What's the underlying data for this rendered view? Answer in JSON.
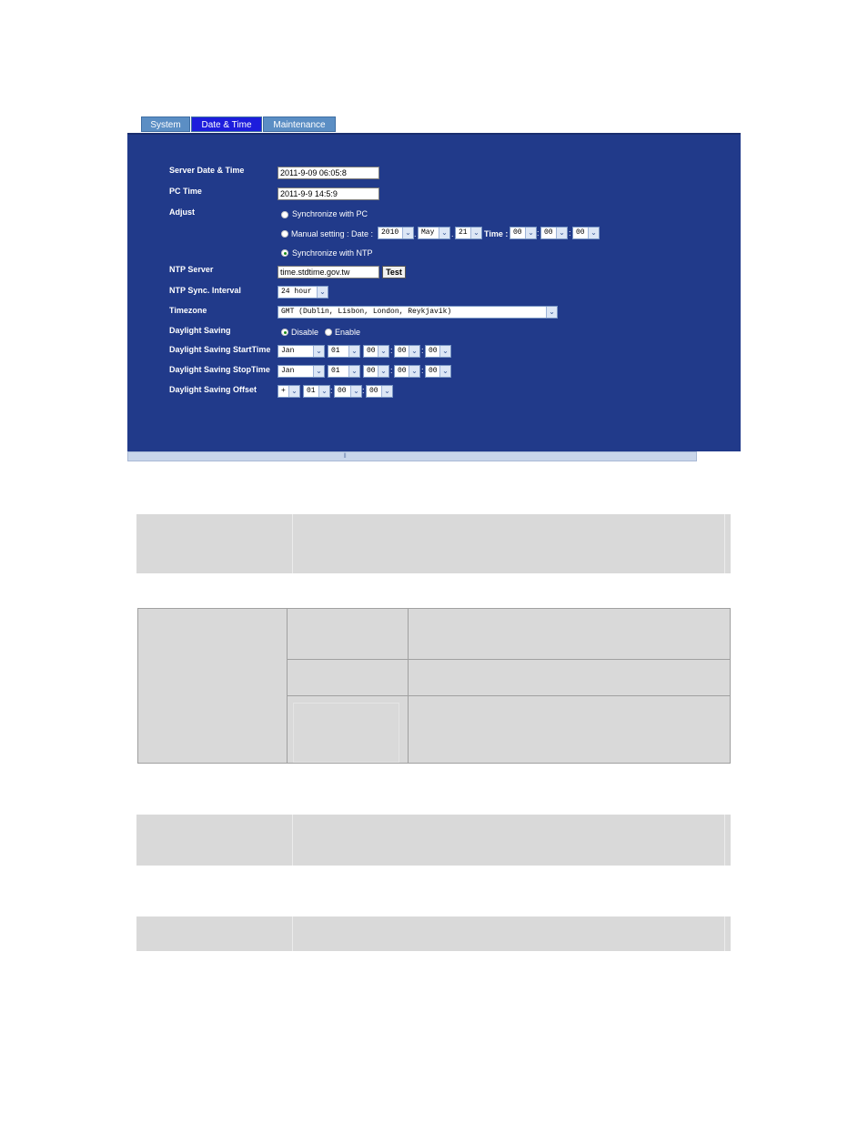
{
  "tabs": [
    {
      "label": "System",
      "active": false
    },
    {
      "label": "Date & Time",
      "active": true
    },
    {
      "label": "Maintenance",
      "active": false
    }
  ],
  "form": {
    "server_date_time": {
      "label": "Server Date & Time",
      "value": "2011-9-09 06:05:8"
    },
    "pc_time": {
      "label": "PC Time",
      "value": "2011-9-9 14:5:9"
    },
    "adjust": {
      "label": "Adjust",
      "sync_pc": "Synchronize with PC",
      "manual_setting": "Manual setting : Date :",
      "date_year": "2010",
      "date_month": "May",
      "date_day": "21",
      "time_label": "Time :",
      "time_h": "00",
      "time_m": "00",
      "time_s": "00",
      "sync_ntp": "Synchronize with NTP"
    },
    "ntp_server": {
      "label": "NTP Server",
      "value": "time.stdtime.gov.tw",
      "test_button": "Test"
    },
    "ntp_interval": {
      "label": "NTP Sync. Interval",
      "value": "24 hour"
    },
    "timezone": {
      "label": "Timezone",
      "value": "GMT (Dublin, Lisbon, London, Reykjavik)"
    },
    "daylight_saving": {
      "label": "Daylight Saving",
      "disable": "Disable",
      "enable": "Enable"
    },
    "start_time": {
      "label": "Daylight Saving StartTime",
      "month": "Jan",
      "day": "01",
      "h": "00",
      "m": "00",
      "s": "00"
    },
    "stop_time": {
      "label": "Daylight Saving StopTime",
      "month": "Jan",
      "day": "01",
      "h": "00",
      "m": "00",
      "s": "00"
    },
    "offset": {
      "label": "Daylight Saving Offset",
      "sign": "+",
      "h": "01",
      "m": "00",
      "s": "00"
    }
  },
  "icons": {
    "dropdown": "chevron-down-icon",
    "scroll_grip": "grip-icon"
  },
  "colors": {
    "panel_bg": "#213a8a",
    "tab_active": "#1d1ddc",
    "tab_inactive": "#5b8ec4",
    "table_gray": "#d9d9d9"
  }
}
